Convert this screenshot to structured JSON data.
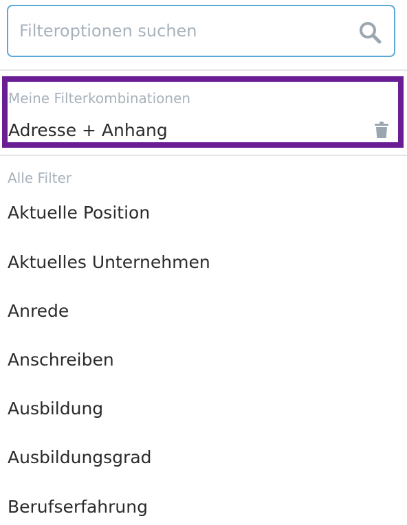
{
  "search": {
    "placeholder": "Filteroptionen suchen",
    "value": "",
    "icon": "search-icon"
  },
  "saved": {
    "section_label": "Meine Filterkombinationen",
    "items": [
      {
        "label": "Adresse + Anhang",
        "delete_icon": "trash-icon"
      }
    ],
    "highlight_color": "#6a1e93"
  },
  "all_filters": {
    "section_label": "Alle Filter",
    "items": [
      {
        "label": "Aktuelle Position"
      },
      {
        "label": "Aktuelles Unternehmen"
      },
      {
        "label": "Anrede"
      },
      {
        "label": "Anschreiben"
      },
      {
        "label": "Ausbildung"
      },
      {
        "label": "Ausbildungsgrad"
      },
      {
        "label": "Berufserfahrung"
      }
    ]
  },
  "colors": {
    "accent": "#5aa8d8",
    "muted_text": "#a7b2bc",
    "text": "#2b2b2b",
    "icon": "#9aa6b0"
  }
}
